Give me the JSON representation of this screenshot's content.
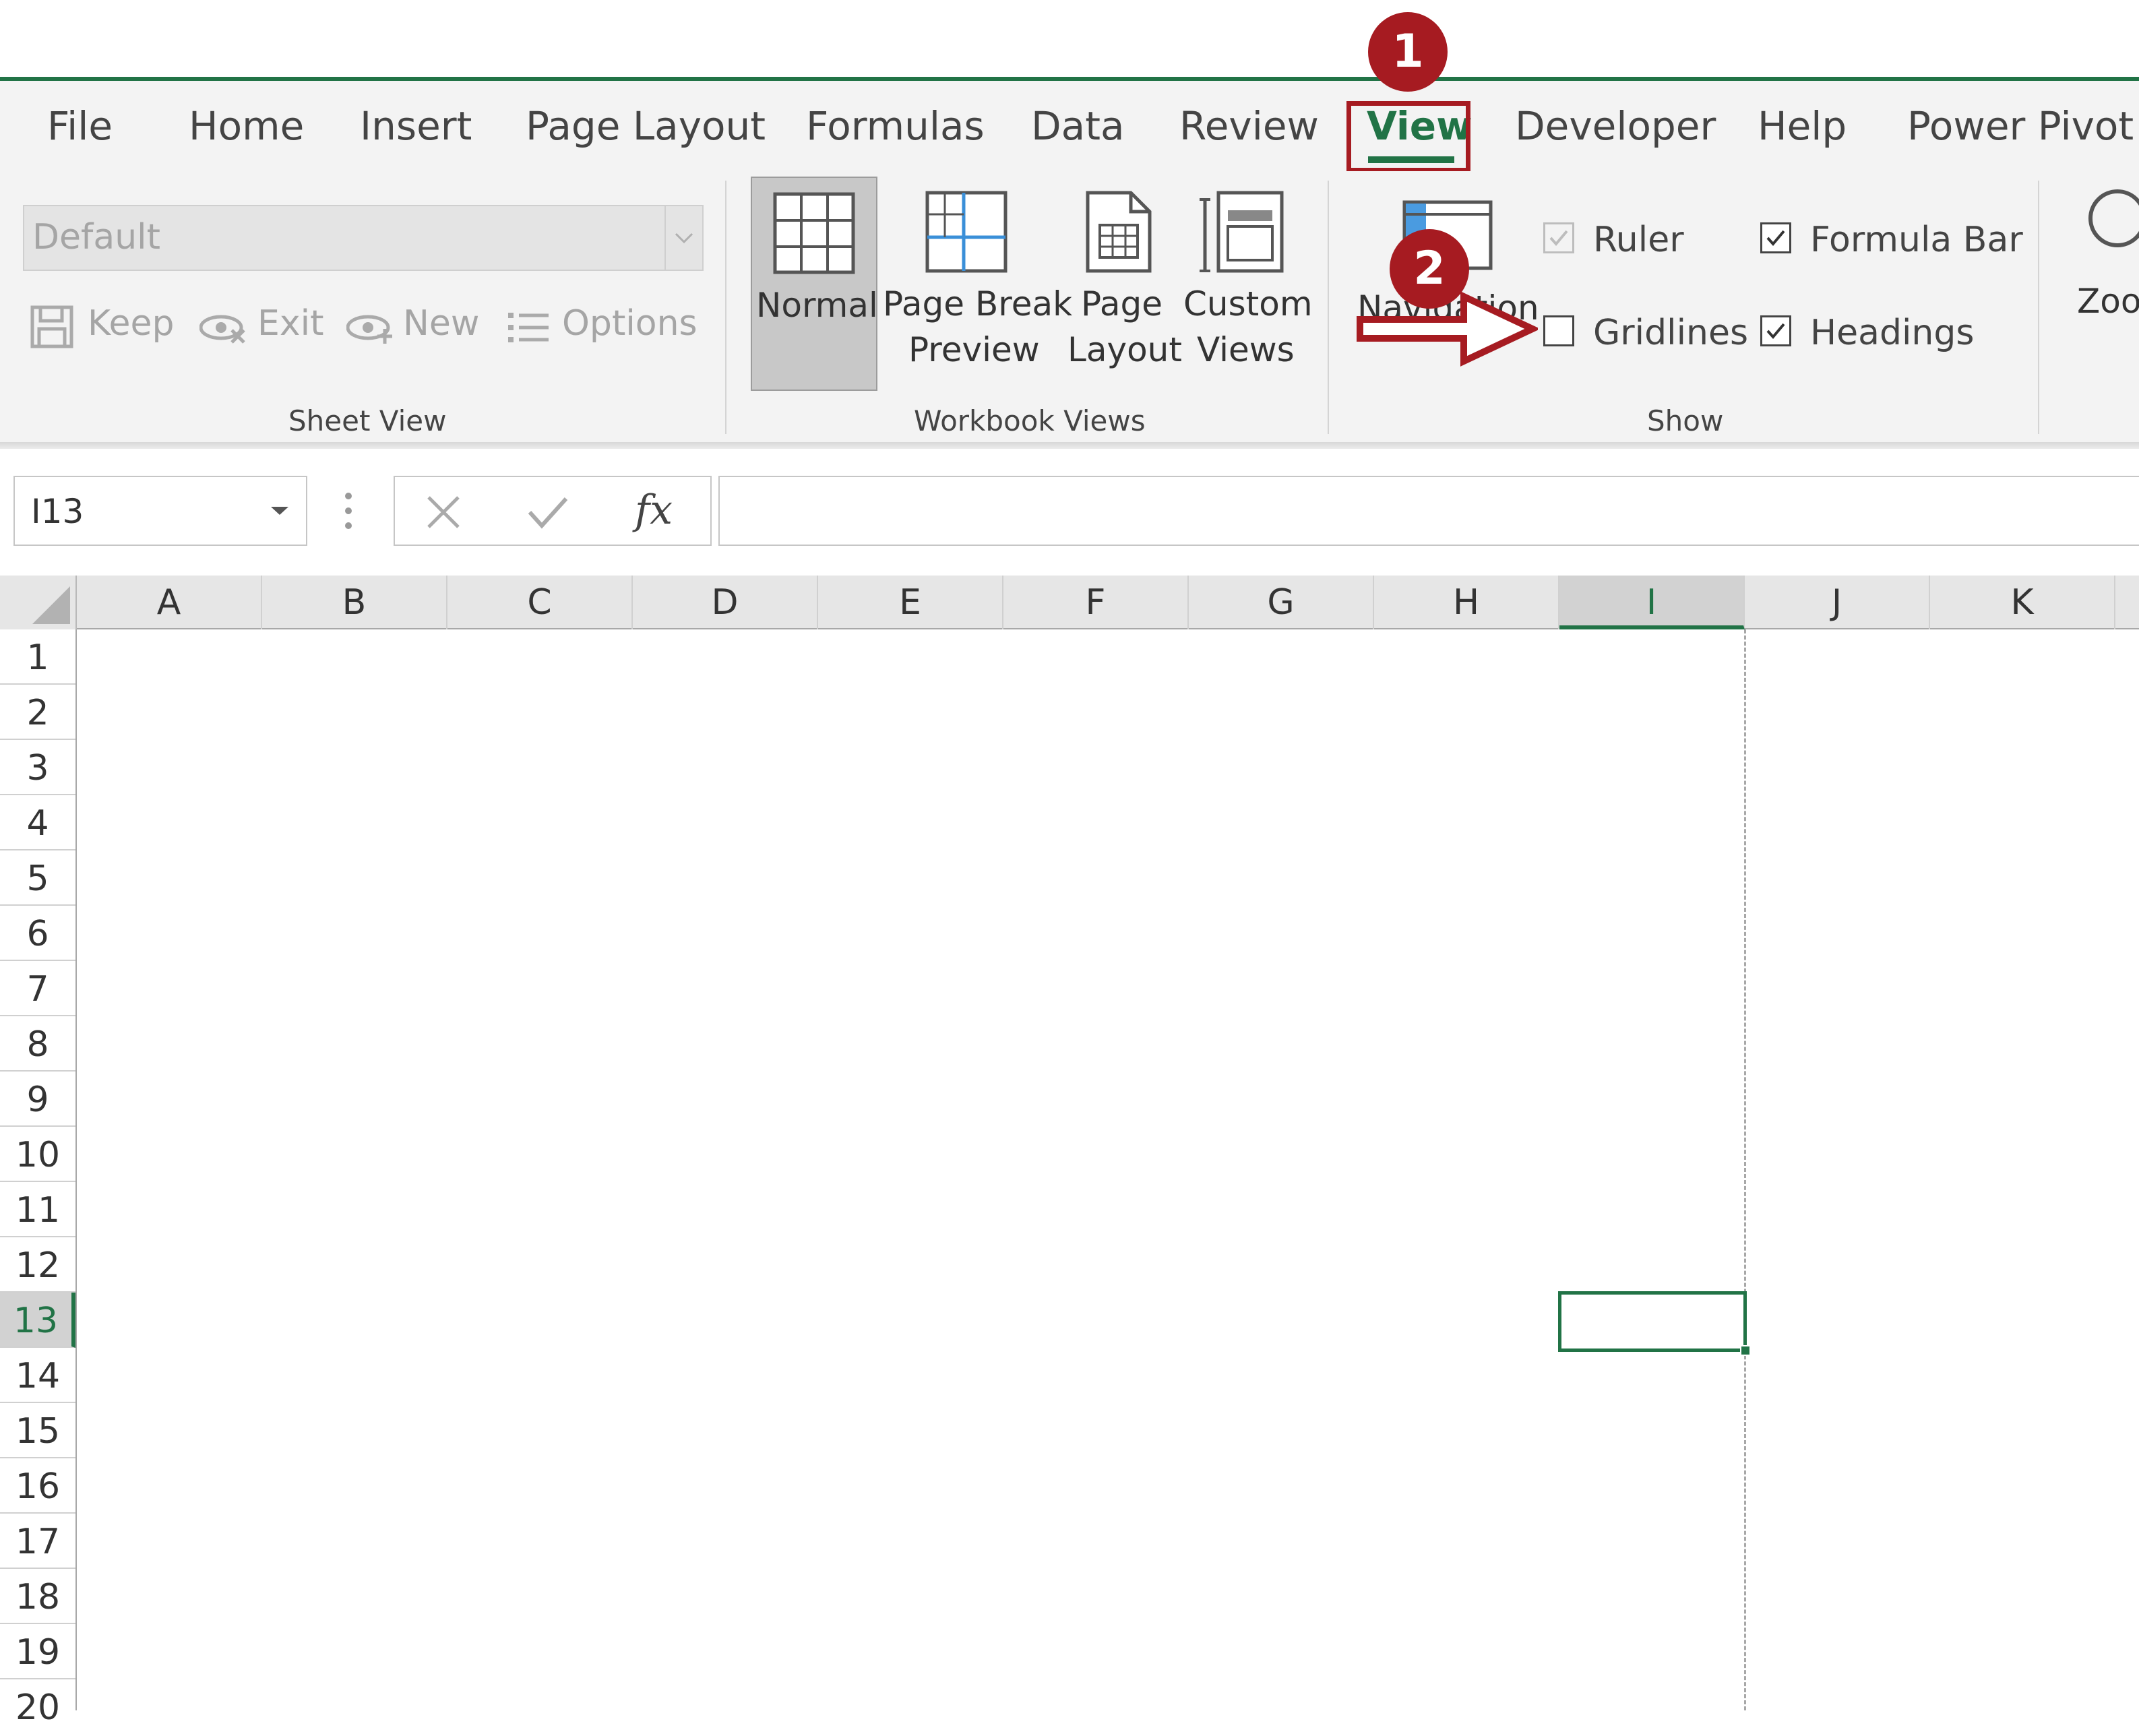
{
  "tabs": [
    {
      "label": "File"
    },
    {
      "label": "Home"
    },
    {
      "label": "Insert"
    },
    {
      "label": "Page Layout"
    },
    {
      "label": "Formulas"
    },
    {
      "label": "Data"
    },
    {
      "label": "Review"
    },
    {
      "label": "View"
    },
    {
      "label": "Developer"
    },
    {
      "label": "Help"
    },
    {
      "label": "Power Pivot"
    }
  ],
  "sheet_view": {
    "dropdown_value": "Default",
    "keep": "Keep",
    "exit": "Exit",
    "new": "New",
    "options": "Options",
    "group_label": "Sheet View"
  },
  "workbook_views": {
    "normal": "Normal",
    "page_break_1": "Page Break",
    "page_break_2": "Preview",
    "page_layout_1": "Page",
    "page_layout_2": "Layout",
    "custom_1": "Custom",
    "custom_2": "Views",
    "group_label": "Workbook Views"
  },
  "show": {
    "navigation": "Navigation",
    "ruler": "Ruler",
    "ruler_checked": true,
    "formula_bar": "Formula Bar",
    "formula_bar_checked": true,
    "gridlines": "Gridlines",
    "gridlines_checked": false,
    "headings": "Headings",
    "headings_checked": true,
    "group_label": "Show"
  },
  "zoom": {
    "label": "Zoo"
  },
  "formula_bar": {
    "name_box": "I13",
    "fx": "fx",
    "formula": ""
  },
  "columns": [
    "A",
    "B",
    "C",
    "D",
    "E",
    "F",
    "G",
    "H",
    "I",
    "J",
    "K"
  ],
  "rows": [
    "1",
    "2",
    "3",
    "4",
    "5",
    "6",
    "7",
    "8",
    "9",
    "10",
    "11",
    "12",
    "13",
    "14",
    "15",
    "16",
    "17",
    "18",
    "19",
    "20"
  ],
  "selected_cell": {
    "column": "I",
    "row": "13"
  },
  "annotations": {
    "step1": "1",
    "step2": "2"
  },
  "colors": {
    "accent": "#217346",
    "annotation": "#a61b21"
  }
}
